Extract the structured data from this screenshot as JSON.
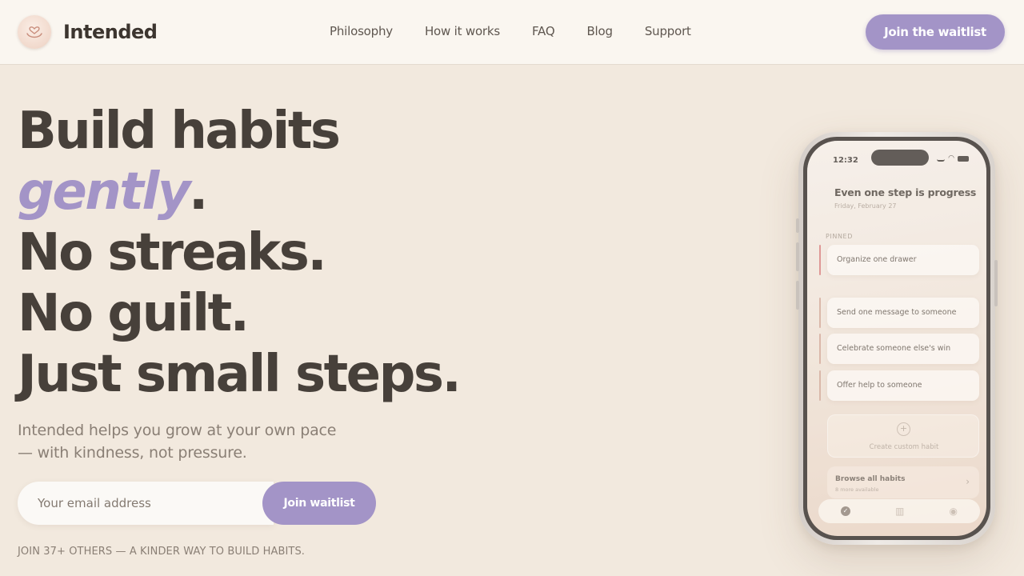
{
  "brand": {
    "name": "Intended",
    "logo_icon": "heart-hands-icon"
  },
  "nav": {
    "items": [
      "Philosophy",
      "How it works",
      "FAQ",
      "Blog",
      "Support"
    ]
  },
  "header_cta": "Join the waitlist",
  "hero": {
    "line1": "Build habits",
    "accent_word": "gently",
    "accent_period": ".",
    "line3": "No streaks.",
    "line4": "No guilt.",
    "line5": "Just small steps.",
    "subtext": "Intended helps you grow at your own pace — with kindness, not pressure.",
    "email_placeholder": "Your email address",
    "join_button": "Join waitlist",
    "social_proof": "JOIN 37+ OTHERS — A KINDER WAY TO BUILD HABITS."
  },
  "colors": {
    "accent": "#a394c7",
    "background": "#f2e9de",
    "header_bg": "#faf6f0",
    "text": "#47403a"
  },
  "phone": {
    "time": "12:32",
    "heading": "Even one step is progress",
    "date": "Friday, February 27",
    "pinned_label": "PINNED",
    "pinned_habit": "Organize one drawer",
    "habits": [
      "Send one message to someone",
      "Celebrate someone else's win",
      "Offer help to someone"
    ],
    "custom_label": "Create custom habit",
    "browse_title": "Browse all habits",
    "browse_sub": "8 more available",
    "tabs": [
      "check-icon",
      "chart-icon",
      "profile-icon"
    ]
  }
}
